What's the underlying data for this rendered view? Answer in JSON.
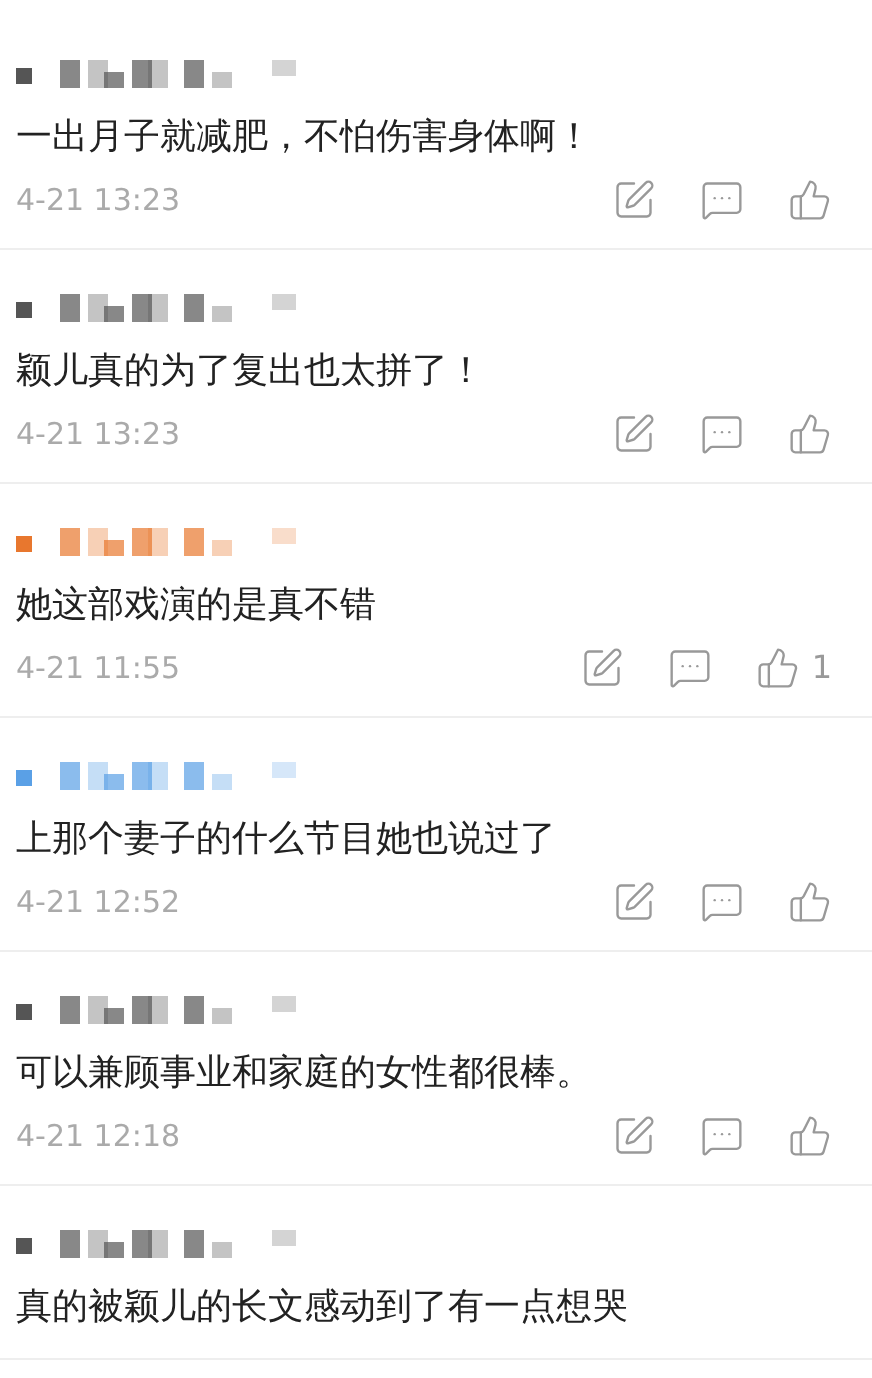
{
  "comments": [
    {
      "color": "#555555",
      "text": "一出月子就减肥，不怕伤害身体啊！",
      "time": "4-21 13:23"
    },
    {
      "color": "#555555",
      "text": "颖儿真的为了复出也太拼了！",
      "time": "4-21 13:23"
    },
    {
      "color": "#e8772e",
      "text": "她这部戏演的是真不错",
      "time": "4-21 11:55",
      "likes": "1"
    },
    {
      "color": "#5aa0e6",
      "text": "上那个妻子的什么节目她也说过了",
      "time": "4-21 12:52"
    },
    {
      "color": "#555555",
      "text": "可以兼顾事业和家庭的女性都很棒。",
      "time": "4-21 12:18"
    },
    {
      "color": "#555555",
      "text": "真的被颖儿的长文感动到了有一点想哭"
    }
  ]
}
